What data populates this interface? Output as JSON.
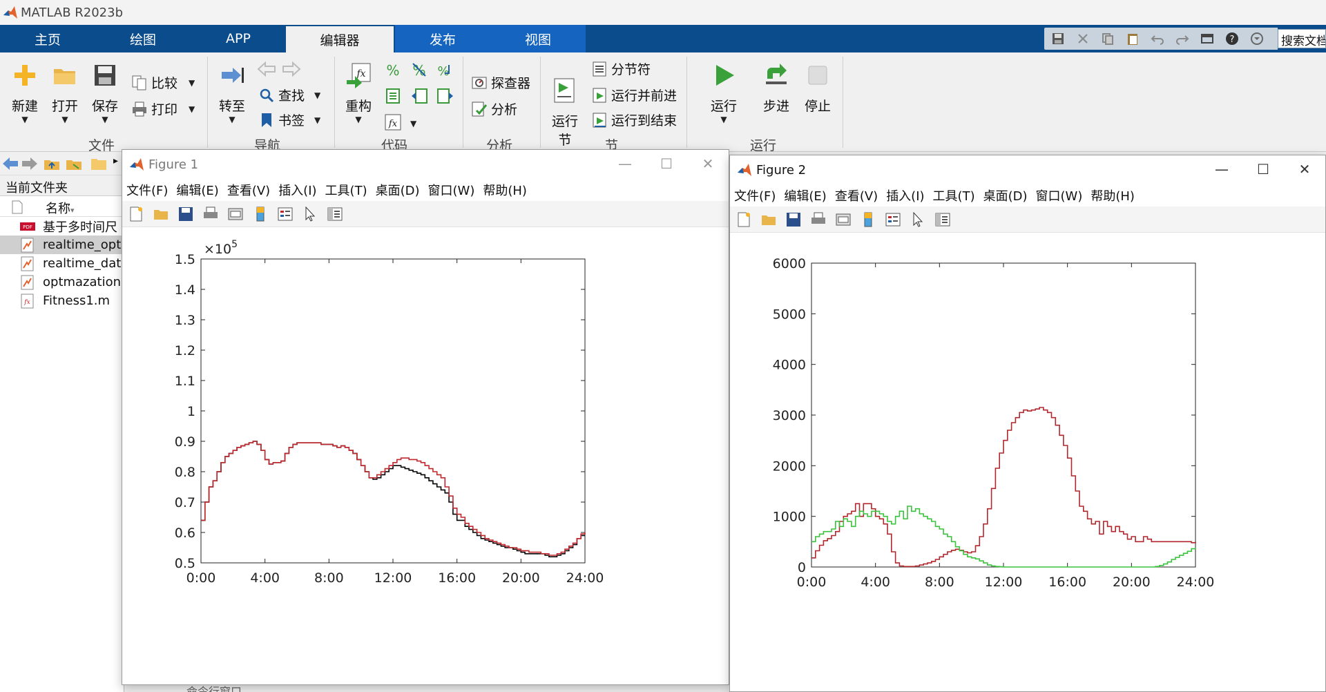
{
  "window": {
    "title": "MATLAB R2023b"
  },
  "ribbon_tabs": [
    "主页",
    "绘图",
    "APP",
    "编辑器",
    "发布",
    "视图"
  ],
  "active_tab": "编辑器",
  "search": {
    "value": "搜索文档"
  },
  "ribbon": {
    "file": {
      "title": "文件",
      "new": "新建",
      "open": "打开",
      "save": "保存",
      "compare": "比较",
      "print": "打印"
    },
    "navigate": {
      "title": "导航",
      "goto": "转至",
      "find": "查找",
      "bookmark": "书签"
    },
    "code": {
      "title": "代码",
      "refactor": "重构"
    },
    "analyze": {
      "title": "分析",
      "profiler": "探查器",
      "analyze": "分析"
    },
    "section": {
      "title": "节",
      "run_section": "运行\n节",
      "section_break": "分节符",
      "run_and_advance": "运行并前进",
      "run_to_end": "运行到结束"
    },
    "run": {
      "title": "运行",
      "run": "运行",
      "step": "步进",
      "stop": "停止"
    }
  },
  "file_browser": {
    "title": "当前文件夹",
    "column_name": "名称",
    "files": [
      {
        "name": "基于多时间尺",
        "type": "pdf"
      },
      {
        "name": "realtime_opt",
        "type": "mlx",
        "selected": true
      },
      {
        "name": "realtime_dat",
        "type": "mlx"
      },
      {
        "name": "optmazation",
        "type": "mlx"
      },
      {
        "name": "Fitness1.m",
        "type": "m"
      }
    ]
  },
  "figure_menu": [
    "文件(F)",
    "编辑(E)",
    "查看(V)",
    "插入(I)",
    "工具(T)",
    "桌面(D)",
    "窗口(W)",
    "帮助(H)"
  ],
  "figure1": {
    "title": "Figure 1",
    "chart_data": {
      "type": "line",
      "exponent_label": "×10",
      "exponent_power": "5",
      "xlim": [
        0,
        24
      ],
      "ylim": [
        0.5,
        1.5
      ],
      "xticks": [
        "0:00",
        "4:00",
        "8:00",
        "12:00",
        "16:00",
        "20:00",
        "24:00"
      ],
      "yticks": [
        "0.5",
        "0.6",
        "0.7",
        "0.8",
        "0.9",
        "1",
        "1.1",
        "1.2",
        "1.3",
        "1.4",
        "1.5"
      ],
      "x": [
        0,
        0.25,
        0.5,
        0.75,
        1,
        1.25,
        1.5,
        1.75,
        2,
        2.25,
        2.5,
        2.75,
        3,
        3.25,
        3.5,
        3.75,
        4,
        4.25,
        4.5,
        4.75,
        5,
        5.25,
        5.5,
        5.75,
        6,
        6.25,
        6.5,
        6.75,
        7,
        7.25,
        7.5,
        7.75,
        8,
        8.25,
        8.5,
        8.75,
        9,
        9.25,
        9.5,
        9.75,
        10,
        10.25,
        10.5,
        10.75,
        11,
        11.25,
        11.5,
        11.75,
        12,
        12.25,
        12.5,
        12.75,
        13,
        13.25,
        13.5,
        13.75,
        14,
        14.25,
        14.5,
        14.75,
        15,
        15.25,
        15.5,
        15.75,
        16,
        16.25,
        16.5,
        16.75,
        17,
        17.25,
        17.5,
        17.75,
        18,
        18.25,
        18.5,
        18.75,
        19,
        19.25,
        19.5,
        19.75,
        20,
        20.25,
        20.5,
        20.75,
        21,
        21.25,
        21.5,
        21.75,
        22,
        22.25,
        22.5,
        22.75,
        23,
        23.25,
        23.5,
        23.75,
        24
      ],
      "series": [
        {
          "color": "#000000",
          "values": [
            0.64,
            0.7,
            0.75,
            0.77,
            0.8,
            0.83,
            0.85,
            0.86,
            0.87,
            0.88,
            0.885,
            0.89,
            0.895,
            0.9,
            0.89,
            0.87,
            0.84,
            0.825,
            0.83,
            0.83,
            0.835,
            0.86,
            0.88,
            0.89,
            0.895,
            0.895,
            0.895,
            0.895,
            0.895,
            0.895,
            0.89,
            0.89,
            0.89,
            0.885,
            0.88,
            0.885,
            0.88,
            0.87,
            0.86,
            0.84,
            0.82,
            0.8,
            0.78,
            0.775,
            0.78,
            0.79,
            0.8,
            0.81,
            0.82,
            0.82,
            0.815,
            0.81,
            0.805,
            0.8,
            0.795,
            0.79,
            0.78,
            0.77,
            0.76,
            0.75,
            0.74,
            0.73,
            0.7,
            0.66,
            0.64,
            0.64,
            0.62,
            0.61,
            0.6,
            0.59,
            0.58,
            0.575,
            0.57,
            0.565,
            0.56,
            0.555,
            0.55,
            0.55,
            0.545,
            0.54,
            0.535,
            0.53,
            0.53,
            0.53,
            0.53,
            0.53,
            0.525,
            0.52,
            0.52,
            0.525,
            0.53,
            0.54,
            0.55,
            0.56,
            0.58,
            0.59,
            0.59
          ]
        },
        {
          "color": "#c0272d",
          "values": [
            0.64,
            0.7,
            0.75,
            0.77,
            0.8,
            0.83,
            0.85,
            0.86,
            0.87,
            0.88,
            0.885,
            0.89,
            0.895,
            0.9,
            0.89,
            0.87,
            0.84,
            0.825,
            0.83,
            0.83,
            0.835,
            0.86,
            0.88,
            0.89,
            0.895,
            0.895,
            0.895,
            0.895,
            0.895,
            0.895,
            0.89,
            0.89,
            0.89,
            0.885,
            0.88,
            0.885,
            0.88,
            0.87,
            0.86,
            0.84,
            0.82,
            0.8,
            0.78,
            0.78,
            0.79,
            0.8,
            0.81,
            0.82,
            0.83,
            0.84,
            0.845,
            0.845,
            0.84,
            0.84,
            0.835,
            0.83,
            0.82,
            0.81,
            0.8,
            0.79,
            0.78,
            0.75,
            0.72,
            0.68,
            0.66,
            0.65,
            0.63,
            0.62,
            0.61,
            0.6,
            0.59,
            0.58,
            0.575,
            0.57,
            0.565,
            0.56,
            0.555,
            0.55,
            0.55,
            0.545,
            0.54,
            0.54,
            0.535,
            0.535,
            0.535,
            0.53,
            0.53,
            0.525,
            0.525,
            0.53,
            0.535,
            0.545,
            0.555,
            0.565,
            0.58,
            0.595,
            0.6
          ]
        }
      ]
    }
  },
  "figure2": {
    "title": "Figure 2",
    "chart_data": {
      "type": "line",
      "xlim": [
        0,
        24
      ],
      "ylim": [
        0,
        6000
      ],
      "xticks": [
        "0:00",
        "4:00",
        "8:00",
        "12:00",
        "16:00",
        "20:00",
        "24:00"
      ],
      "yticks": [
        "0",
        "1000",
        "2000",
        "3000",
        "4000",
        "5000",
        "6000"
      ],
      "x": [
        0,
        0.25,
        0.5,
        0.75,
        1,
        1.25,
        1.5,
        1.75,
        2,
        2.25,
        2.5,
        2.75,
        3,
        3.25,
        3.5,
        3.75,
        4,
        4.25,
        4.5,
        4.75,
        5,
        5.25,
        5.5,
        5.75,
        6,
        6.25,
        6.5,
        6.75,
        7,
        7.25,
        7.5,
        7.75,
        8,
        8.25,
        8.5,
        8.75,
        9,
        9.25,
        9.5,
        9.75,
        10,
        10.25,
        10.5,
        10.75,
        11,
        11.25,
        11.5,
        11.75,
        12,
        12.25,
        12.5,
        12.75,
        13,
        13.25,
        13.5,
        13.75,
        14,
        14.25,
        14.5,
        14.75,
        15,
        15.25,
        15.5,
        15.75,
        16,
        16.25,
        16.5,
        16.75,
        17,
        17.25,
        17.5,
        17.75,
        18,
        18.25,
        18.5,
        18.75,
        19,
        19.25,
        19.5,
        19.75,
        20,
        20.25,
        20.5,
        20.75,
        21,
        21.25,
        21.5,
        21.75,
        22,
        22.25,
        22.5,
        22.75,
        23,
        23.25,
        23.5,
        23.75,
        24
      ],
      "series": [
        {
          "color": "#b0262c",
          "values": [
            180,
            320,
            430,
            520,
            560,
            620,
            700,
            900,
            1000,
            1050,
            1100,
            1250,
            1000,
            1250,
            1250,
            1150,
            1000,
            950,
            850,
            650,
            300,
            80,
            20,
            10,
            10,
            10,
            20,
            40,
            60,
            80,
            110,
            150,
            200,
            250,
            300,
            330,
            350,
            330,
            300,
            280,
            300,
            420,
            600,
            850,
            1150,
            1550,
            1950,
            2250,
            2500,
            2700,
            2850,
            2950,
            3050,
            3100,
            3080,
            3100,
            3120,
            3150,
            3100,
            3050,
            2950,
            2800,
            2600,
            2400,
            2150,
            1800,
            1500,
            1200,
            1100,
            950,
            850,
            900,
            650,
            900,
            800,
            700,
            800,
            700,
            650,
            550,
            600,
            500,
            500,
            600,
            550,
            500,
            500,
            500,
            500,
            500,
            500,
            500,
            500,
            500,
            500,
            480,
            500
          ]
        },
        {
          "color": "#39c23b",
          "values": [
            500,
            600,
            650,
            700,
            700,
            750,
            900,
            800,
            950,
            900,
            800,
            1000,
            1100,
            1050,
            1000,
            1100,
            1100,
            1050,
            1000,
            900,
            850,
            1000,
            1100,
            950,
            1200,
            1100,
            1150,
            1050,
            1000,
            950,
            900,
            800,
            750,
            650,
            600,
            500,
            400,
            320,
            250,
            200,
            180,
            160,
            120,
            80,
            40,
            20,
            10,
            5,
            0,
            0,
            0,
            0,
            0,
            0,
            0,
            0,
            0,
            0,
            0,
            0,
            0,
            0,
            0,
            0,
            0,
            0,
            0,
            0,
            0,
            0,
            0,
            0,
            0,
            0,
            0,
            0,
            0,
            0,
            0,
            0,
            0,
            0,
            0,
            0,
            0,
            0,
            10,
            30,
            60,
            100,
            150,
            190,
            230,
            270,
            310,
            360,
            380
          ]
        }
      ]
    }
  },
  "status_fragment": "命令行窗口"
}
